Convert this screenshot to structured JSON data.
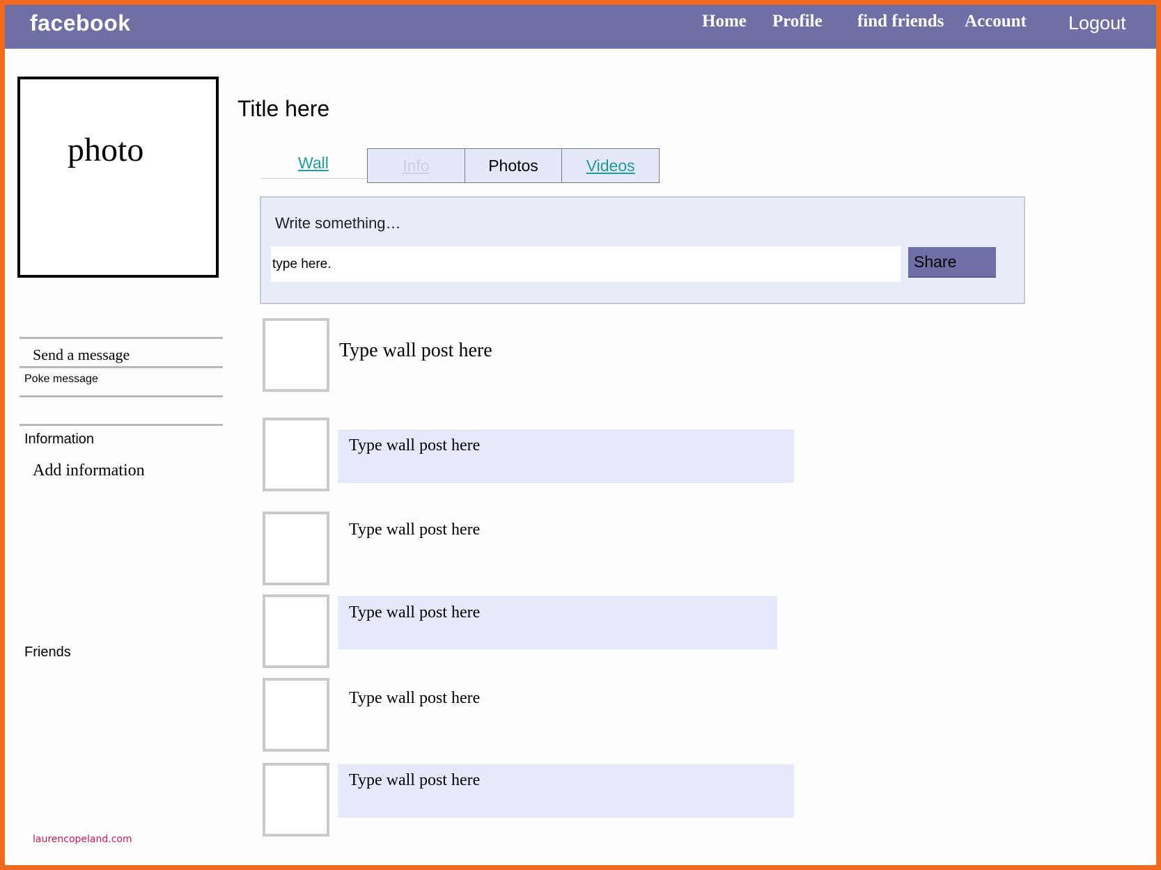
{
  "header": {
    "logo": "facebook",
    "nav": [
      "Home",
      "Profile",
      "find friends",
      "Account"
    ],
    "logout": "Logout"
  },
  "sidebar": {
    "photo_label": "photo",
    "send_message": "Send a message",
    "poke_message": "Poke message",
    "information_heading": "Information",
    "add_information": "Add information",
    "friends_heading": "Friends"
  },
  "main": {
    "title": "Title here",
    "tabs": [
      "Wall",
      "Info",
      "Photos",
      "Videos"
    ],
    "composer": {
      "label": "Write something…",
      "input_value": "type here.",
      "share_label": "Share"
    },
    "posts": [
      "Type wall post here",
      "Type wall post here",
      "Type wall post here",
      "Type wall post here",
      "Type wall post here",
      "Type wall post here"
    ]
  },
  "watermark": "laurencopeland.com",
  "colors": {
    "frame_border": "#f06a1d",
    "topbar": "#6d6fa5",
    "link_teal": "#1f9b9b",
    "post_highlight": "#e6e9fb"
  }
}
